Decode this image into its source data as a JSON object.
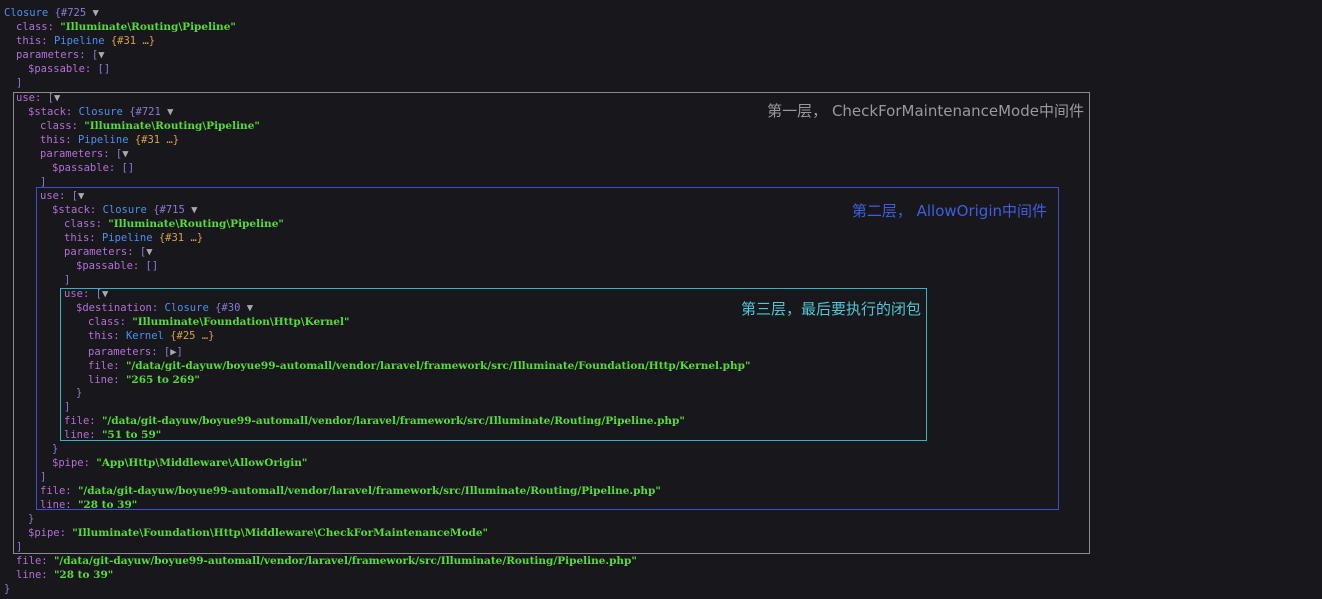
{
  "dump": {
    "root_head": "Closure",
    "root_id": "{#725",
    "class_key": "class:",
    "class_val": "\"Illuminate\\Routing\\Pipeline\"",
    "this_key": "this:",
    "this_cls": "Pipeline",
    "this_ref": "{#31 …}",
    "params_key": "parameters:",
    "passable": "$passable:",
    "empty": "[]",
    "use_key": "use:",
    "stack_key": "$stack:",
    "closure": "Closure",
    "stack1_id": "{#721",
    "stack2_id": "{#715",
    "dest_key": "$destination:",
    "dest_id": "{#30",
    "kernel_class": "\"Illuminate\\Foundation\\Http\\Kernel\"",
    "kernel_cls": "Kernel",
    "kernel_ref": "{#25 …}",
    "file_key": "file:",
    "line_key": "line:",
    "file_kernel": "\"/data/git-dayuw/boyue99-automall/vendor/laravel/framework/src/Illuminate/Foundation/Http/Kernel.php\"",
    "line_kernel": "\"265 to 269\"",
    "file_pipeline": "\"/data/git-dayuw/boyue99-automall/vendor/laravel/framework/src/Illuminate/Routing/Pipeline.php\"",
    "line_51": "\"51 to 59\"",
    "line_28": "\"28 to 39\"",
    "pipe_key": "$pipe:",
    "pipe_allow": "\"App\\Http\\Middleware\\AllowOrigin\"",
    "pipe_check": "\"Illuminate\\Foundation\\Http\\Middleware\\CheckForMaintenanceMode\""
  },
  "annotations": {
    "layer1": "第一层， CheckForMaintenanceMode中间件",
    "layer2": "第二层， AllowOrigin中间件",
    "layer3": "第三层，最后要执行的闭包"
  },
  "colors": {
    "background": "#18171b",
    "key": "#b36fd6",
    "class": "#4a90f0",
    "string": "#56db3a",
    "box1": "#8a8a8f",
    "box2": "#3c4fd0",
    "box3": "#2fb5c2"
  }
}
